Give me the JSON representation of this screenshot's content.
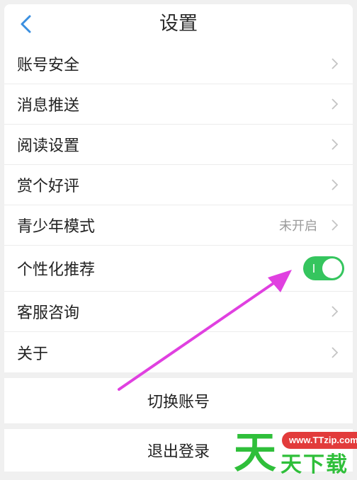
{
  "header": {
    "title": "设置",
    "back_icon": "chevron-left-icon"
  },
  "colors": {
    "accent": "#3a8fe0",
    "toggle_on": "#35c55e",
    "arrow": "#e040e0",
    "watermark_green": "#2fbf3a",
    "watermark_red": "#e23b3b"
  },
  "settings": {
    "account_security": "账号安全",
    "push": "消息推送",
    "reading": "阅读设置",
    "rate": "赏个好评",
    "teen_mode": "青少年模式",
    "teen_mode_status": "未开启",
    "personalized": "个性化推荐",
    "personalized_on": true,
    "support": "客服咨询",
    "about": "关于"
  },
  "actions": {
    "switch_account": "切换账号",
    "logout": "退出登录"
  },
  "watermark": {
    "big": "天",
    "url": "www.TTzip.com",
    "text": "天下载"
  }
}
